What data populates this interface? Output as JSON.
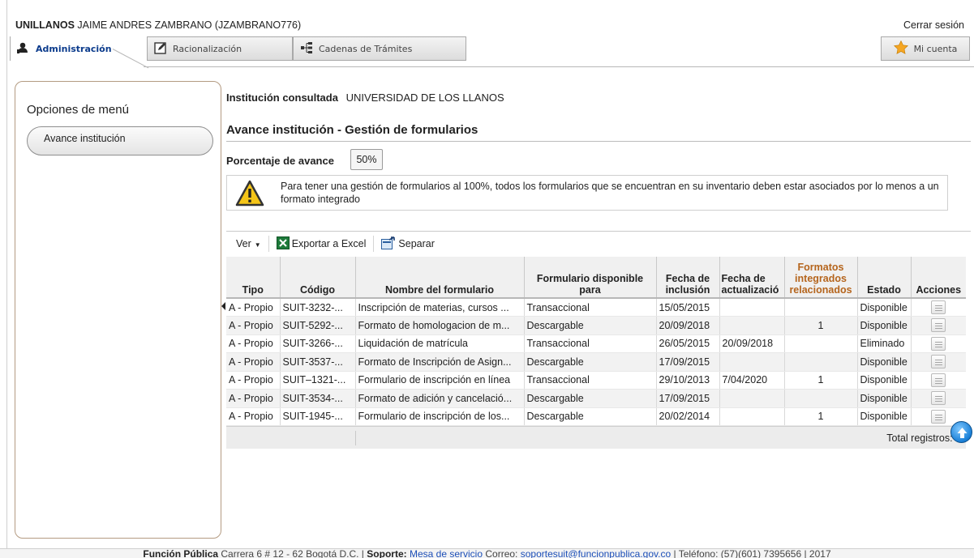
{
  "header": {
    "org": "UNILLANOS",
    "user": "JAIME ANDRES ZAMBRANO (JZAMBRANO776)",
    "logout": "Cerrar sesión"
  },
  "tabs": [
    {
      "label": "Administración",
      "icon": "user-icon",
      "active": true
    },
    {
      "label": "Racionalización",
      "icon": "edit-icon",
      "active": false
    },
    {
      "label": "Cadenas de Trámites",
      "icon": "tree-icon",
      "active": false
    }
  ],
  "account_tab": {
    "label": "Mi cuenta",
    "icon": "star-icon"
  },
  "sidebar": {
    "title": "Opciones de menú",
    "items": [
      {
        "label": "Avance institución"
      }
    ]
  },
  "content": {
    "institution_label": "Institución consultada",
    "institution_value": "UNIVERSIDAD DE LOS LLANOS",
    "heading": "Avance institución - Gestión de formularios",
    "progress_label": "Porcentaje de avance",
    "progress_value": "50%",
    "warning_text": "Para tener una gestión de formularios al 100%, todos los formularios que se encuentran en su inventario deben estar asociados por lo menos a un formato integrado"
  },
  "toolbar": {
    "ver": "Ver",
    "export": "Exportar a Excel",
    "separate": "Separar"
  },
  "table": {
    "headers": [
      "Tipo",
      "Código",
      "Nombre del formulario",
      "Formulario disponible para",
      "Fecha de inclusión",
      "Fecha de actualizació",
      "Formatos integrados relacionados",
      "Estado",
      "Acciones"
    ],
    "rows": [
      [
        "A - Propio",
        "SUIT-3232-...",
        "Inscripción de materias, cursos ...",
        "Transaccional",
        "15/05/2015",
        "",
        "",
        "Disponible"
      ],
      [
        "A - Propio",
        "SUIT-5292-...",
        "Formato de homologacion de m...",
        "Descargable",
        "20/09/2018",
        "",
        "1",
        "Disponible"
      ],
      [
        "A - Propio",
        "SUIT-3266-...",
        "Liquidación de matrícula",
        "Transaccional",
        "26/05/2015",
        "20/09/2018",
        "",
        "Eliminado"
      ],
      [
        "A - Propio",
        "SUIT-3537-...",
        "Formato de Inscripción de Asign...",
        "Descargable",
        "17/09/2015",
        "",
        "",
        "Disponible"
      ],
      [
        "A - Propio",
        "SUIT–1321-...",
        "Formulario de inscripción en línea",
        "Transaccional",
        "29/10/2013",
        "7/04/2020",
        "1",
        "Disponible"
      ],
      [
        "A - Propio",
        "SUIT-3534-...",
        "Formato de adición y cancelació...",
        "Descargable",
        "17/09/2015",
        "",
        "",
        "Disponible"
      ],
      [
        "A - Propio",
        "SUIT-1945-...",
        "Formulario de inscripción de los...",
        "Descargable",
        "20/02/2014",
        "",
        "1",
        "Disponible"
      ]
    ],
    "total": "Total registros: 7"
  },
  "footer": {
    "org": "Función Pública",
    "address": "Carrera 6 # 12 - 62 Bogotá D.C. |",
    "support_label": "Soporte:",
    "support_link": "Mesa de servicio",
    "email_label": "Correo:",
    "email": "soportesuit@funcionpublica.gov.co",
    "phone": "| Teléfono: (57)(601) 7395656 | 2017"
  }
}
